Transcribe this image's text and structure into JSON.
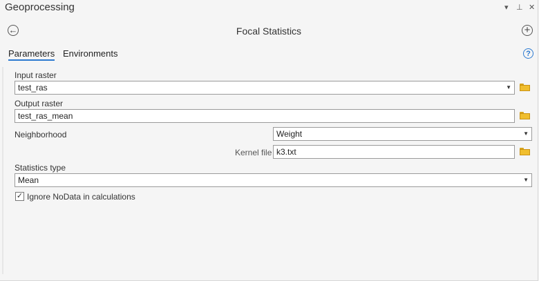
{
  "pane": {
    "title": "Geoprocessing",
    "controls": [
      "▾",
      "⊥",
      "✕"
    ]
  },
  "header": {
    "tool_title": "Focal Statistics",
    "back_glyph": "←",
    "add_glyph": "+"
  },
  "tabs": [
    {
      "label": "Parameters",
      "active": true
    },
    {
      "label": "Environments",
      "active": false
    }
  ],
  "help_glyph": "?",
  "params": {
    "input_raster": {
      "label": "Input raster",
      "value": "test_ras"
    },
    "output_raster": {
      "label": "Output raster",
      "value": "test_ras_mean"
    },
    "neighborhood": {
      "label": "Neighborhood",
      "value": "Weight"
    },
    "kernel_file": {
      "label": "Kernel file",
      "value": "k3.txt"
    },
    "statistics_type": {
      "label": "Statistics type",
      "value": "Mean"
    },
    "ignore_nodata": {
      "label": "Ignore NoData in calculations",
      "checked": true,
      "check_glyph": "✓"
    }
  },
  "colors": {
    "accent": "#2b79d0",
    "folder": "#f0be2e"
  }
}
